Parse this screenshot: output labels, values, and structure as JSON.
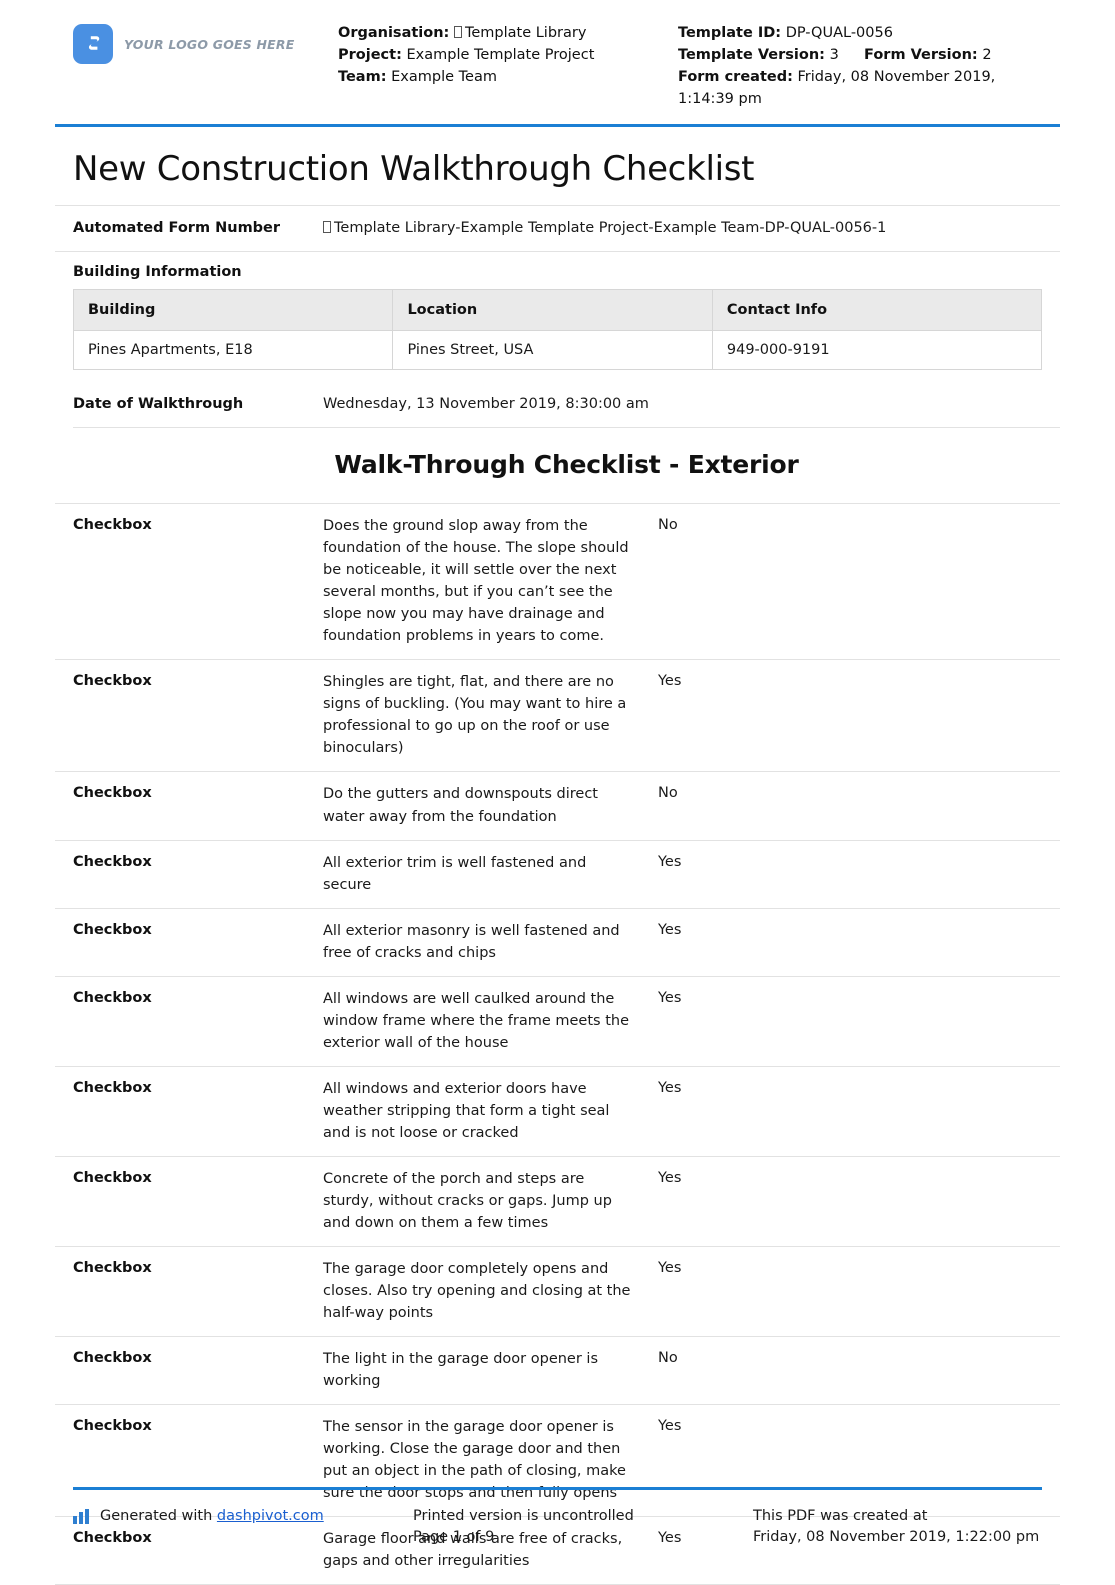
{
  "header": {
    "logo_text": "YOUR LOGO GOES HERE",
    "organisation_label": "Organisation:",
    "organisation_value": "Template Library",
    "project_label": "Project:",
    "project_value": "Example Template Project",
    "team_label": "Team:",
    "team_value": "Example Team",
    "template_id_label": "Template ID:",
    "template_id_value": "DP-QUAL-0056",
    "template_version_label": "Template Version:",
    "template_version_value": "3",
    "form_version_label": "Form Version:",
    "form_version_value": "2",
    "form_created_label": "Form created:",
    "form_created_value": "Friday, 08 November 2019, 1:14:39 pm"
  },
  "title": "New Construction Walkthrough Checklist",
  "automated_form": {
    "label": "Automated Form Number",
    "value": "Template Library-Example Template Project-Example Team-DP-QUAL-0056-1"
  },
  "building_information": {
    "section_label": "Building Information",
    "columns": [
      "Building",
      "Location",
      "Contact Info"
    ],
    "rows": [
      [
        "Pines Apartments, E18",
        "Pines Street, USA",
        "949-000-9191"
      ]
    ]
  },
  "date_of_walkthrough": {
    "label": "Date of Walkthrough",
    "value": "Wednesday, 13 November 2019, 8:30:00 am"
  },
  "checklist": {
    "heading": "Walk-Through Checklist - Exterior",
    "items": [
      {
        "type": "Checkbox",
        "description": "Does the ground slop away from the foundation of the house. The slope should be noticeable, it will settle over the next several months, but if you can’t see the slope now you may have drainage and foundation problems in years to come.",
        "answer": "No"
      },
      {
        "type": "Checkbox",
        "description": "Shingles are tight, flat, and there are no signs of buckling. (You may want to hire a professional to go up on the roof or use binoculars)",
        "answer": "Yes"
      },
      {
        "type": "Checkbox",
        "description": "Do the gutters and downspouts direct water away from the foundation",
        "answer": "No"
      },
      {
        "type": "Checkbox",
        "description": "All exterior trim is well fastened and secure",
        "answer": "Yes"
      },
      {
        "type": "Checkbox",
        "description": "All exterior masonry is well fastened and free of cracks and chips",
        "answer": "Yes"
      },
      {
        "type": "Checkbox",
        "description": "All windows are well caulked around the window frame where the frame meets the exterior wall of the house",
        "answer": "Yes"
      },
      {
        "type": "Checkbox",
        "description": "All windows and exterior doors have weather stripping that form a tight seal and is not loose or cracked",
        "answer": "Yes"
      },
      {
        "type": "Checkbox",
        "description": "Concrete of the porch and steps are sturdy, without cracks or gaps. Jump up and down on them a few times",
        "answer": "Yes"
      },
      {
        "type": "Checkbox",
        "description": "The garage door completely opens and closes. Also try opening and closing at the half-way points",
        "answer": "Yes"
      },
      {
        "type": "Checkbox",
        "description": "The light in the garage door opener is working",
        "answer": "No"
      },
      {
        "type": "Checkbox",
        "description": "The sensor in the garage door opener is working. Close the garage door and then put an object in the path of closing, make sure the door stops and then fully opens",
        "answer": "Yes"
      },
      {
        "type": "Checkbox",
        "description": "Garage floor and walls are free of cracks, gaps and other irregularities",
        "answer": "Yes"
      }
    ]
  },
  "footer": {
    "generated_prefix": "Generated with",
    "generated_link": "dashpivot.com",
    "printed_notice": "Printed version is uncontrolled",
    "page_number": "Page 1 of 9",
    "created_label": "This PDF was created at",
    "created_value": "Friday, 08 November 2019, 1:22:00 pm"
  },
  "colors": {
    "accent_blue": "#1b7fd4",
    "logo_blue": "#4a90e2",
    "table_header_gray": "#eaeaea",
    "link_blue": "#1a5fd0"
  }
}
